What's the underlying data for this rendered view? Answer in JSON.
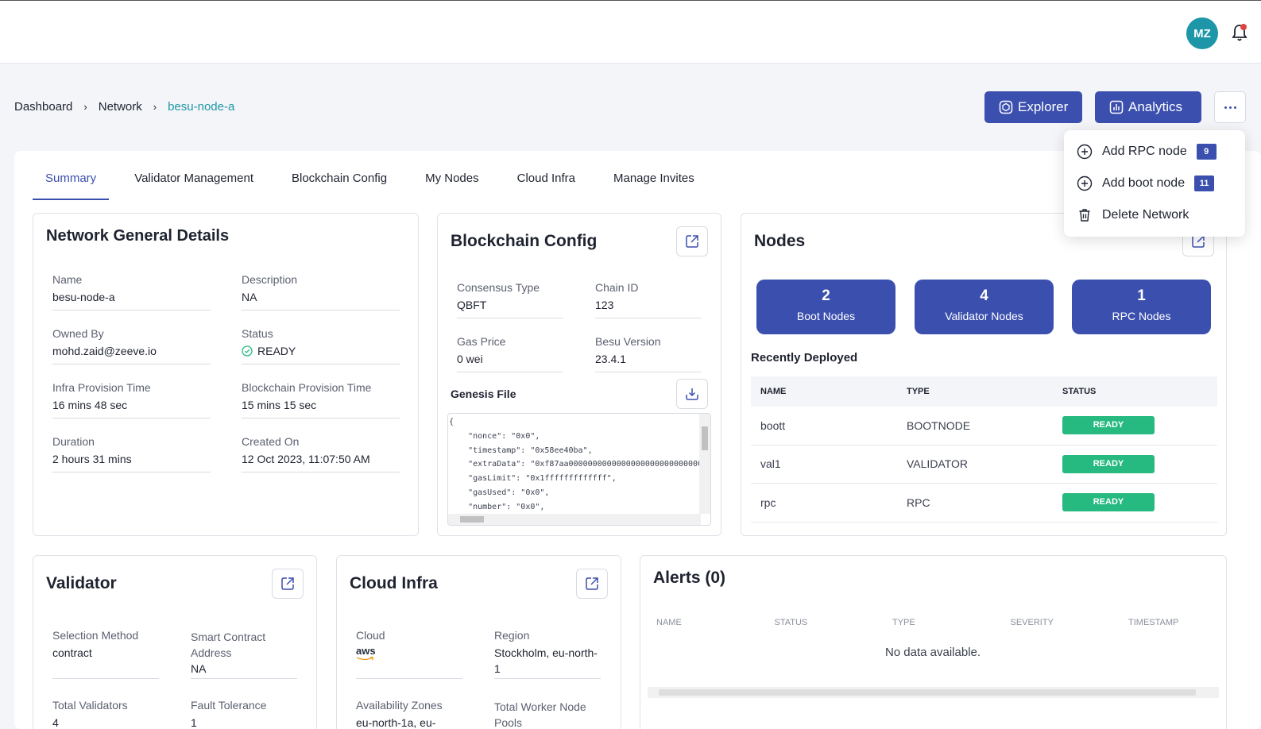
{
  "header": {
    "avatar_initials": "MZ",
    "bell_icon": "bell-icon"
  },
  "breadcrumb": {
    "items": [
      "Dashboard",
      "Network",
      "besu-node-a"
    ],
    "separator": "›"
  },
  "actions": {
    "explorer_label": "Explorer",
    "analytics_label": "Analytics"
  },
  "more_menu": {
    "items": [
      {
        "label": "Add RPC node",
        "badge": "9",
        "icon": "plus-circle-icon"
      },
      {
        "label": "Add boot node",
        "badge": "11",
        "icon": "plus-circle-icon"
      },
      {
        "label": "Delete Network",
        "badge": "",
        "icon": "trash-icon"
      }
    ]
  },
  "tabs": [
    {
      "label": "Summary",
      "active": true
    },
    {
      "label": "Validator Management"
    },
    {
      "label": "Blockchain Config"
    },
    {
      "label": "My Nodes"
    },
    {
      "label": "Cloud Infra"
    },
    {
      "label": "Manage Invites"
    }
  ],
  "network_details": {
    "title": "Network General Details",
    "fields": [
      {
        "label": "Name",
        "value": "besu-node-a"
      },
      {
        "label": "Description",
        "value": "NA"
      },
      {
        "label": "Owned By",
        "value": "mohd.zaid@zeeve.io"
      },
      {
        "label": "Status",
        "value": "READY"
      },
      {
        "label": "Infra Provision Time",
        "value": "16 mins 48 sec"
      },
      {
        "label": "Blockchain Provision Time",
        "value": "15 mins 15 sec"
      },
      {
        "label": "Duration",
        "value": "2 hours 31 mins"
      },
      {
        "label": "Created On",
        "value": "12 Oct 2023, 11:07:50 AM"
      }
    ]
  },
  "blockchain_config": {
    "title": "Blockchain Config",
    "fields": [
      {
        "label": "Consensus Type",
        "value": "QBFT"
      },
      {
        "label": "Chain ID",
        "value": "123"
      },
      {
        "label": "Gas Price",
        "value": "0 wei"
      },
      {
        "label": "Besu Version",
        "value": "23.4.1"
      }
    ],
    "genesis_title": "Genesis File",
    "genesis_text": "{\n    \"nonce\": \"0x0\",\n    \"timestamp\": \"0x58ee40ba\",\n    \"extraData\": \"0xf87aa0000000000000000000000000000000000000\n    \"gasLimit\": \"0x1fffffffffffff\",\n    \"gasUsed\": \"0x0\",\n    \"number\": \"0x0\","
  },
  "nodes": {
    "title": "Nodes",
    "cards": [
      {
        "count": "2",
        "label": "Boot Nodes"
      },
      {
        "count": "4",
        "label": "Validator Nodes"
      },
      {
        "count": "1",
        "label": "RPC Nodes"
      }
    ],
    "recent_title": "Recently Deployed",
    "columns": [
      "NAME",
      "TYPE",
      "STATUS"
    ],
    "rows": [
      {
        "name": "boott",
        "type": "BOOTNODE",
        "status": "READY"
      },
      {
        "name": "val1",
        "type": "VALIDATOR",
        "status": "READY"
      },
      {
        "name": "rpc",
        "type": "RPC",
        "status": "READY"
      }
    ]
  },
  "validator": {
    "title": "Validator",
    "fields": [
      {
        "label": "Selection Method",
        "value": "contract"
      },
      {
        "label": "Smart Contract Address",
        "value": "NA"
      },
      {
        "label": "Total Validators",
        "value": "4"
      },
      {
        "label": "Fault Tolerance",
        "value": "1"
      }
    ]
  },
  "cloud_infra": {
    "title": "Cloud Infra",
    "fields": [
      {
        "label": "Cloud",
        "value": "aws"
      },
      {
        "label": "Region",
        "value": "Stockholm, eu-north-1"
      },
      {
        "label": "Availability Zones",
        "value": "eu-north-1a, eu-"
      },
      {
        "label": "Total Worker Node Pools",
        "value": ""
      }
    ]
  },
  "alerts": {
    "title": "Alerts (0)",
    "columns": [
      "NAME",
      "STATUS",
      "TYPE",
      "SEVERITY",
      "TIMESTAMP"
    ],
    "empty_text": "No data available."
  },
  "colors": {
    "primary": "#3b4fae",
    "teal": "#1d97a8",
    "ready": "#26b980"
  }
}
